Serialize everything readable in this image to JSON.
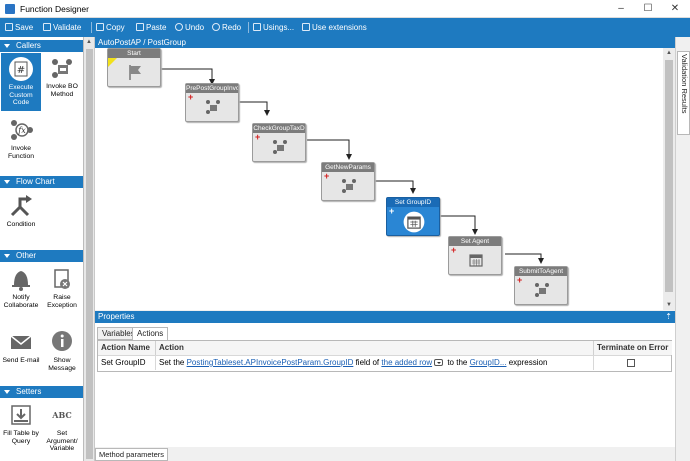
{
  "window": {
    "title": "Function Designer",
    "minimize": "–",
    "maximize": "☐",
    "close": "✕"
  },
  "toolbar": {
    "save": "Save",
    "validate": "Validate",
    "copy": "Copy",
    "paste": "Paste",
    "undo": "Undo",
    "redo": "Redo",
    "usings": "Usings...",
    "use_extensions": "Use extensions"
  },
  "toolbox": {
    "callers": {
      "title": "Callers",
      "items": [
        "Execute Custom Code",
        "Invoke BO Method",
        "Invoke Function"
      ]
    },
    "flowchart": {
      "title": "Flow Chart",
      "items": [
        "Condition"
      ]
    },
    "other": {
      "title": "Other",
      "items": [
        "Notify Collaborate",
        "Raise Exception",
        "Send E-mail",
        "Show Message"
      ]
    },
    "setters": {
      "title": "Setters",
      "items": [
        "Fill Table by Query",
        "Set Argument/ Variable"
      ]
    }
  },
  "breadcrumb": "AutoPostAP / PostGroup",
  "right_tab": "Validation Results",
  "flow": {
    "nodes": [
      "Start",
      "PrePostGroupInvoi",
      "CheckGroupTaxD",
      "GetNewParams",
      "Set GroupID",
      "Set Agent",
      "SubmitToAgent"
    ],
    "active_node": "Set GroupID"
  },
  "properties": {
    "title": "Properties",
    "pin": "⇡",
    "tabs": [
      "Variables",
      "Actions"
    ],
    "active_tab": "Actions",
    "columns": [
      "Action Name",
      "Action",
      "Terminate on Error"
    ],
    "rows": [
      {
        "name": "Set GroupID",
        "text_set": "Set the",
        "link_field": "PostingTableset.APInvoicePostParam.GroupID",
        "text_field": "field of",
        "link_row": "the added row",
        "text_to": "to the",
        "link_expr": "GroupID...",
        "text_expr": "expression",
        "terminate": false
      }
    ]
  },
  "bottom_tab": "Method parameters",
  "colors": {
    "accent": "#1e7ac0",
    "node_active": "#2a86d4",
    "node_header": "#7c7c7c",
    "plus": "#d31f1f"
  }
}
